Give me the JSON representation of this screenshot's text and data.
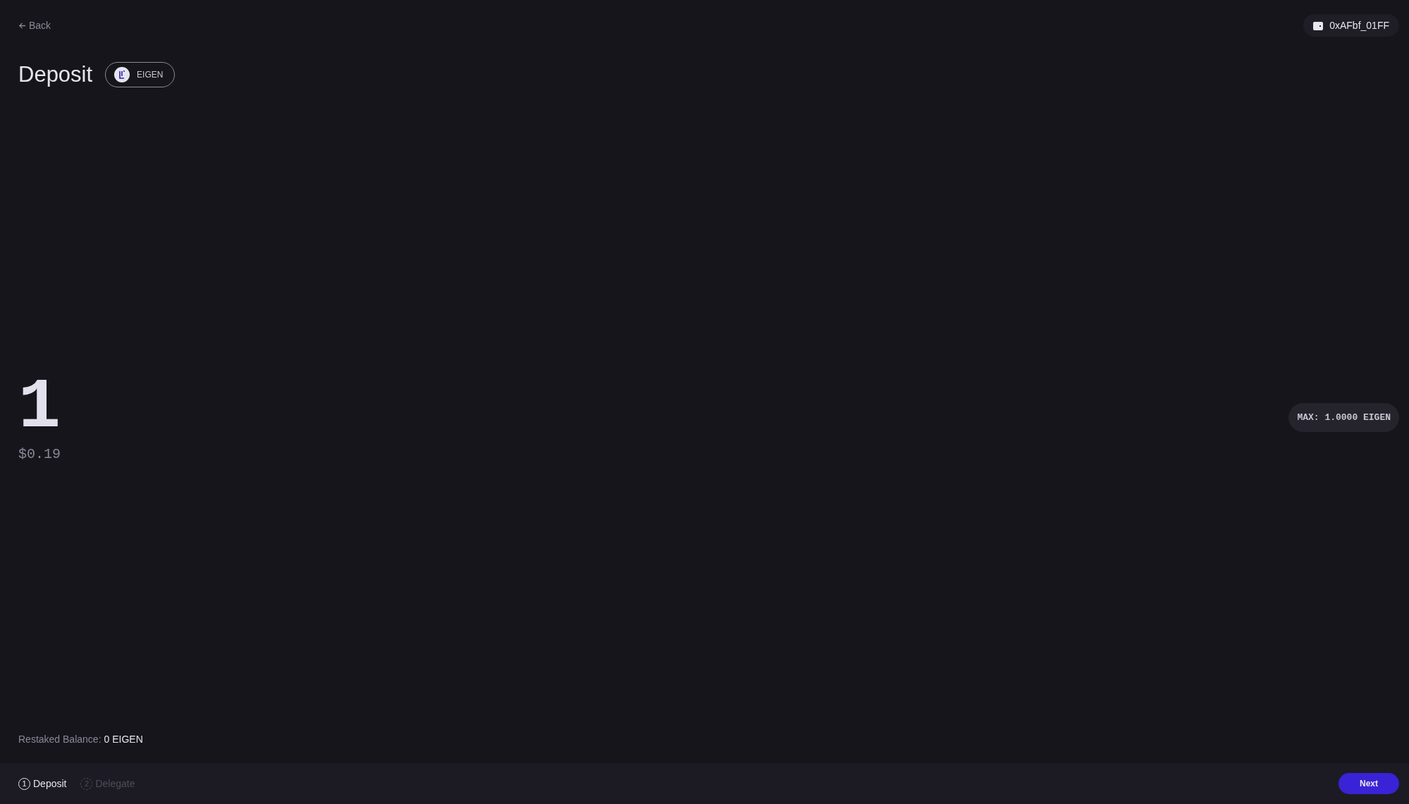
{
  "header": {
    "back": "Back",
    "wallet": "0xAFbf_01FF"
  },
  "title": "Deposit",
  "token": {
    "symbol": "EIGEN"
  },
  "amount": {
    "value": "1",
    "usd": "$0.19",
    "max": "MAX: 1.0000 EIGEN"
  },
  "balance": {
    "label": "Restaked Balance:",
    "value": "0 EIGEN"
  },
  "steps": [
    {
      "number": "1",
      "label": "Deposit",
      "selected": true
    },
    {
      "number": "2",
      "label": "Delegate",
      "selected": false
    }
  ],
  "next_button": "Next"
}
